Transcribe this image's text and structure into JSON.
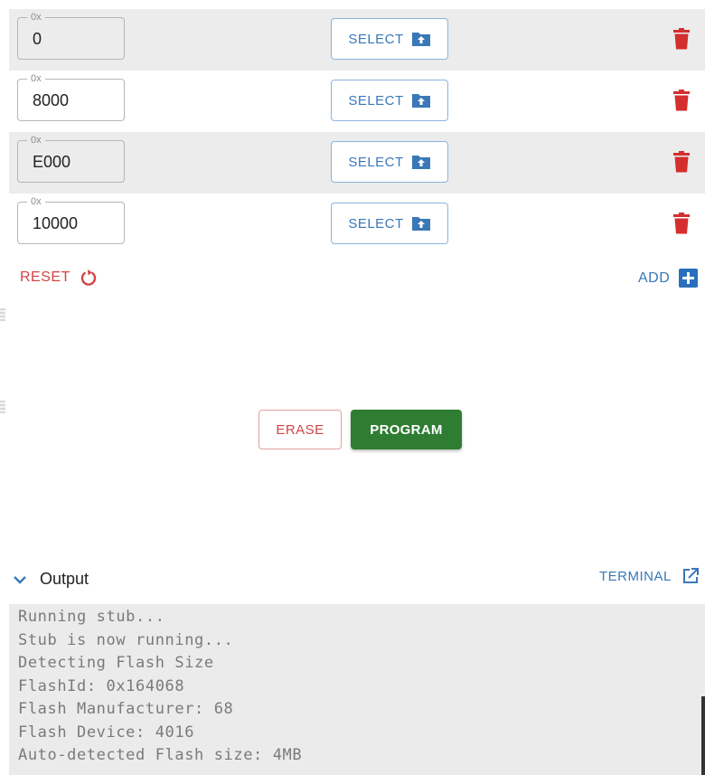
{
  "flash_rows": [
    {
      "legend": "0x",
      "address": "0",
      "select_label": "SELECT",
      "shaded": true
    },
    {
      "legend": "0x",
      "address": "8000",
      "select_label": "SELECT",
      "shaded": false
    },
    {
      "legend": "0x",
      "address": "E000",
      "select_label": "SELECT",
      "shaded": true
    },
    {
      "legend": "0x",
      "address": "10000",
      "select_label": "SELECT",
      "shaded": false
    }
  ],
  "actions": {
    "reset_label": "RESET",
    "add_label": "ADD",
    "erase_label": "ERASE",
    "program_label": "PROGRAM"
  },
  "output": {
    "title": "Output",
    "terminal_label": "TERMINAL",
    "lines": [
      "Running stub...",
      "Stub is now running...",
      "Detecting Flash Size",
      "FlashId: 0x164068",
      "Flash Manufacturer: 68",
      "Flash Device: 4016",
      "Auto-detected Flash size: 4MB"
    ]
  },
  "colors": {
    "accent_blue": "#3a78b8",
    "danger_red": "#d24545",
    "program_green": "#2e7d32",
    "row_shade": "#ececec"
  },
  "icons": {
    "select": "folder-upload-icon",
    "delete": "trash-icon",
    "reset": "reset-icon",
    "add": "plus-box-icon",
    "collapse": "chevron-down-icon",
    "terminal": "open-external-icon"
  }
}
